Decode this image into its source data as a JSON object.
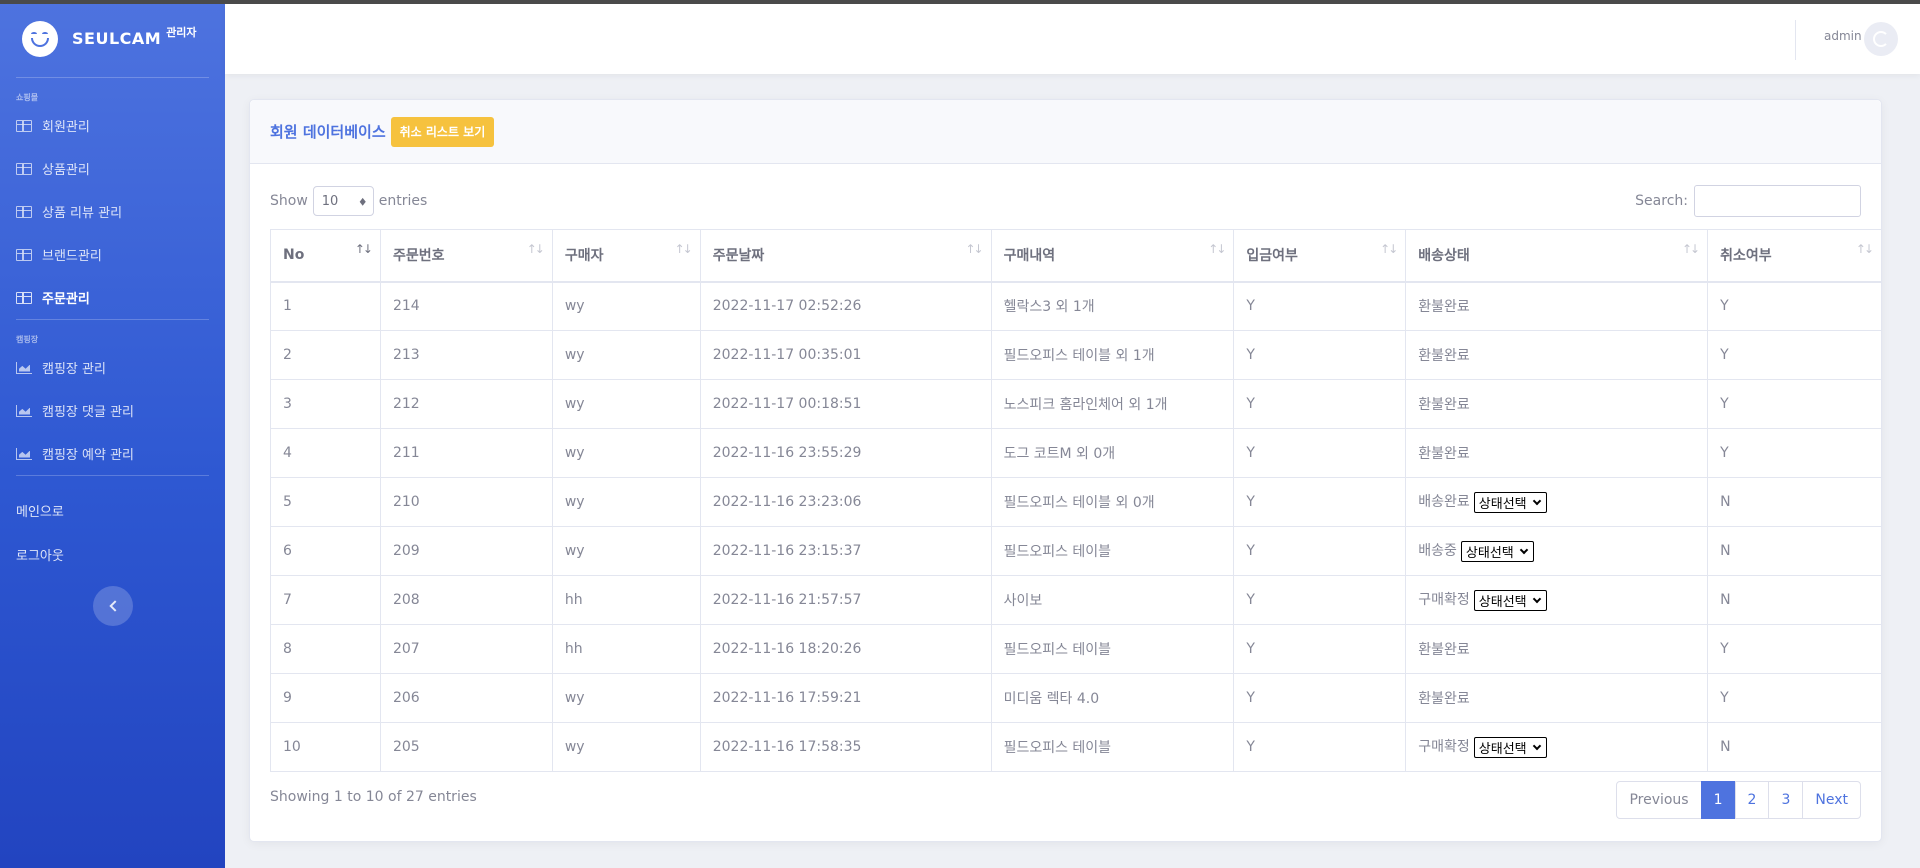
{
  "brand": {
    "name": "SEULCAM",
    "suffix": "관리자"
  },
  "sidebar": {
    "sections": [
      {
        "heading": "쇼핑몰",
        "items": [
          {
            "label": "회원관리",
            "icon": "table-icon"
          },
          {
            "label": "상품관리",
            "icon": "table-icon"
          },
          {
            "label": "상품 리뷰 관리",
            "icon": "table-icon"
          },
          {
            "label": "브랜드관리",
            "icon": "table-icon"
          },
          {
            "label": "주문관리",
            "icon": "table-icon",
            "active": true
          }
        ]
      },
      {
        "heading": "캠핑장",
        "items": [
          {
            "label": "캠핑장 관리",
            "icon": "chart-area-icon"
          },
          {
            "label": "캠핑장 댓글 관리",
            "icon": "chart-area-icon"
          },
          {
            "label": "캠핑장 예약 관리",
            "icon": "chart-area-icon"
          }
        ]
      }
    ],
    "links": [
      {
        "label": "메인으로"
      },
      {
        "label": "로그아웃"
      }
    ]
  },
  "topbar": {
    "user": "admin"
  },
  "card": {
    "title": "회원 데이터베이스",
    "cancel_button": "취소 리스트 보기"
  },
  "table_controls": {
    "show_prefix": "Show",
    "show_value": "10",
    "show_suffix": "entries",
    "search_label": "Search:",
    "search_value": ""
  },
  "table": {
    "columns": [
      "No",
      "주문번호",
      "구매자",
      "주문날짜",
      "구매내역",
      "입금여부",
      "배송상태",
      "취소여부"
    ],
    "rows": [
      {
        "no": "1",
        "order": "214",
        "buyer": "wy",
        "date": "2022-11-17 02:52:26",
        "items": "헬락스3 외 1개",
        "paid": "Y",
        "ship": "환불완료",
        "select": "",
        "cancel": "Y"
      },
      {
        "no": "2",
        "order": "213",
        "buyer": "wy",
        "date": "2022-11-17 00:35:01",
        "items": "필드오피스 테이블 외 1개",
        "paid": "Y",
        "ship": "환불완료",
        "select": "",
        "cancel": "Y"
      },
      {
        "no": "3",
        "order": "212",
        "buyer": "wy",
        "date": "2022-11-17 00:18:51",
        "items": "노스피크 홈라인체어 외 1개",
        "paid": "Y",
        "ship": "환불완료",
        "select": "",
        "cancel": "Y"
      },
      {
        "no": "4",
        "order": "211",
        "buyer": "wy",
        "date": "2022-11-16 23:55:29",
        "items": "도그 코트M 외 0개",
        "paid": "Y",
        "ship": "환불완료",
        "select": "",
        "cancel": "Y"
      },
      {
        "no": "5",
        "order": "210",
        "buyer": "wy",
        "date": "2022-11-16 23:23:06",
        "items": "필드오피스 테이블 외 0개",
        "paid": "Y",
        "ship": "배송완료",
        "select": "상태선택",
        "cancel": "N"
      },
      {
        "no": "6",
        "order": "209",
        "buyer": "wy",
        "date": "2022-11-16 23:15:37",
        "items": "필드오피스 테이블",
        "paid": "Y",
        "ship": "배송중",
        "select": "상태선택",
        "cancel": "N"
      },
      {
        "no": "7",
        "order": "208",
        "buyer": "hh",
        "date": "2022-11-16 21:57:57",
        "items": "사이보",
        "paid": "Y",
        "ship": "구매확정",
        "select": "상태선택",
        "cancel": "N"
      },
      {
        "no": "8",
        "order": "207",
        "buyer": "hh",
        "date": "2022-11-16 18:20:26",
        "items": "필드오피스 테이블",
        "paid": "Y",
        "ship": "환불완료",
        "select": "",
        "cancel": "Y"
      },
      {
        "no": "9",
        "order": "206",
        "buyer": "wy",
        "date": "2022-11-16 17:59:21",
        "items": "미디움 렉타 4.0",
        "paid": "Y",
        "ship": "환불완료",
        "select": "",
        "cancel": "Y"
      },
      {
        "no": "10",
        "order": "205",
        "buyer": "wy",
        "date": "2022-11-16 17:58:35",
        "items": "필드오피스 테이블",
        "paid": "Y",
        "ship": "구매확정",
        "select": "상태선택",
        "cancel": "N"
      }
    ]
  },
  "footer": {
    "info": "Showing 1 to 10 of 27 entries",
    "pagination": {
      "previous": "Previous",
      "pages": [
        "1",
        "2",
        "3"
      ],
      "active": "1",
      "next": "Next"
    }
  }
}
